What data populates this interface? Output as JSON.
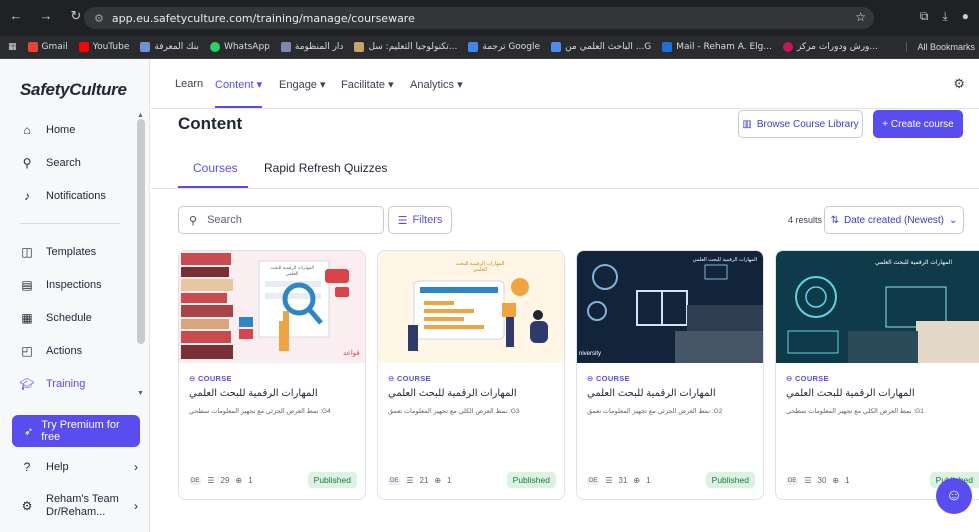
{
  "browser": {
    "url": "app.eu.safetyculture.com/training/manage/courseware",
    "bookmarks": [
      "Gmail",
      "YouTube",
      "بنك المعرفة",
      "WhatsApp",
      "دار المنظومة",
      "تكنولوجيا التعليم: سل...",
      "ترجمة Google",
      "الباحث العلمي من ...G",
      "Mail - Reham A. Elg...",
      "ورش ودورات مركز..."
    ],
    "all_bookmarks": "All Bookmarks"
  },
  "sidebar": {
    "logo": "SafetyCulture",
    "items": [
      {
        "label": "Home",
        "icon": "home-icon"
      },
      {
        "label": "Search",
        "icon": "search-icon"
      },
      {
        "label": "Notifications",
        "icon": "bell-icon"
      },
      {
        "label": "Templates",
        "icon": "templates-icon"
      },
      {
        "label": "Inspections",
        "icon": "clipboard-icon"
      },
      {
        "label": "Schedule",
        "icon": "calendar-icon"
      },
      {
        "label": "Actions",
        "icon": "actions-icon"
      },
      {
        "label": "Training",
        "icon": "graduation-cap-icon"
      }
    ],
    "premium_label": "Try Premium for free",
    "help_label": "Help",
    "team_line1": "Reham's Team",
    "team_line2": "Dr/Reham..."
  },
  "topnav": {
    "items": [
      "Learn",
      "Content",
      "Engage",
      "Facilitate",
      "Analytics"
    ],
    "active": "Content"
  },
  "page": {
    "title": "Content",
    "browse_label": "Browse Course Library",
    "create_label": "+ Create course",
    "tabs": [
      "Courses",
      "Rapid Refresh Quizzes"
    ],
    "search_placeholder": "Search",
    "filters_label": "Filters",
    "results": "4 results",
    "sort_label": "Date created (Newest)"
  },
  "cards": [
    {
      "tag": "COURSE",
      "title": "المهارات الرقمية للبحث العلمي",
      "subtitle": "G4: نمط العرض الجزئي مع تجهيز المعلومات سطحي",
      "badge": "DE",
      "lessons": "29",
      "learners": "1",
      "status": "Published"
    },
    {
      "tag": "COURSE",
      "title": "المهارات الرقمية للبحث العلمي",
      "subtitle": "G3: نمط العرض الكلي مع تجهيز المعلومات تعمق",
      "badge": "DE",
      "lessons": "21",
      "learners": "1",
      "status": "Published"
    },
    {
      "tag": "COURSE",
      "title": "المهارات الرقمية للبحث العلمي",
      "subtitle": "G2: نمط العرض الجزئي مع تجهيز المعلومات تعمق",
      "badge": "DE",
      "lessons": "31",
      "learners": "1",
      "status": "Published"
    },
    {
      "tag": "COURSE",
      "title": "المهارات الرقمية للبحث العلمي",
      "subtitle": "G1: نمط العرض الكلي مع تجهيز المعلومات سطحي",
      "badge": "DE",
      "lessons": "30",
      "learners": "1",
      "status": "Published"
    }
  ],
  "card_images": [
    {
      "caption": "المهارات الرقمية للبحث العلمي",
      "corner": "قواعد"
    },
    {
      "caption": "المهارات الرقمية للبحث العلمي"
    },
    {
      "caption": "المهارات الرقمية للبحث العلمي",
      "corner": "niversity"
    },
    {
      "caption": "المهارات الرقمية للبحث العلمي"
    }
  ],
  "colors": {
    "accent": "#5a4df0",
    "published_bg": "#dcf3e3",
    "published_text": "#1c7a3a"
  }
}
